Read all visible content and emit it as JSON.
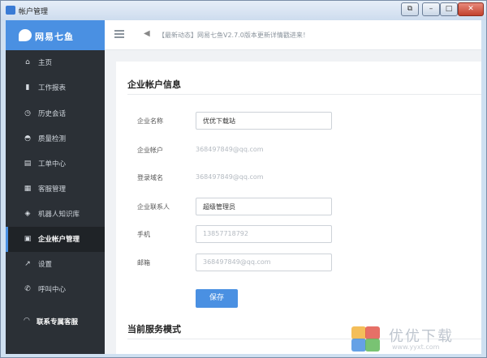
{
  "window": {
    "title": "帐户管理",
    "buttons": {
      "extra": "⧉",
      "minimize": "–",
      "maximize": "□",
      "close": "✕"
    }
  },
  "brand": {
    "name": "网易七鱼"
  },
  "sidebar": {
    "items": [
      {
        "label": "主页",
        "icon": "home-icon",
        "glyph": "⌂"
      },
      {
        "label": "工作报表",
        "icon": "bar-chart-icon",
        "glyph": "▮"
      },
      {
        "label": "历史会话",
        "icon": "clock-icon",
        "glyph": "◷"
      },
      {
        "label": "质量检测",
        "icon": "gauge-icon",
        "glyph": "◓"
      },
      {
        "label": "工单中心",
        "icon": "document-icon",
        "glyph": "▤"
      },
      {
        "label": "客服管理",
        "icon": "grid-icon",
        "glyph": "▦"
      },
      {
        "label": "机器人知识库",
        "icon": "robot-icon",
        "glyph": "◈"
      },
      {
        "label": "企业帐户管理",
        "icon": "building-icon",
        "glyph": "▣"
      },
      {
        "label": "设置",
        "icon": "wrench-icon",
        "glyph": "↗"
      },
      {
        "label": "呼叫中心",
        "icon": "phone-icon",
        "glyph": "✆"
      }
    ],
    "active_index": 7,
    "bottom": {
      "label": "联系专属客服",
      "icon": "headset-icon",
      "glyph": "◠"
    }
  },
  "topbar": {
    "notice": "【最新动态】网易七鱼V2.7.0版本更新详情戳进来！",
    "speaker_glyph": "◀"
  },
  "content": {
    "section1_title": "企业帐户信息",
    "fields": [
      {
        "label": "企业名称",
        "value": "优优下载站",
        "type": "input"
      },
      {
        "label": "企业帐户",
        "value": "368497849@qq.com",
        "type": "text"
      },
      {
        "label": "登录域名",
        "value": "368497849@qq.com",
        "type": "text"
      },
      {
        "label": "企业联系人",
        "value": "超级管理员",
        "type": "input"
      },
      {
        "label": "手机",
        "value": "13857718792",
        "type": "input"
      },
      {
        "label": "邮箱",
        "value": "368497849@qq.com",
        "type": "input"
      }
    ],
    "save_label": "保存",
    "section2_title": "当前服务模式"
  },
  "watermark": {
    "text": "优优下载",
    "url": "www.yyxt.com"
  },
  "colors": {
    "accent": "#4a90e2",
    "sidebar_bg": "#2b3036",
    "close_btn": "#c2422d"
  }
}
